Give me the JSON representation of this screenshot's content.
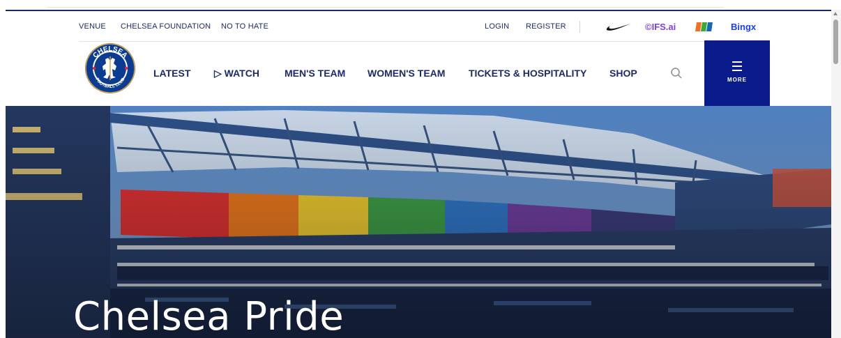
{
  "utility_links": {
    "venue": "VENUE",
    "foundation": "CHELSEA FOUNDATION",
    "no_to_hate": "NO TO HATE",
    "login": "LOGIN",
    "register": "REGISTER"
  },
  "sponsors": {
    "ifs": "©IFS.ai",
    "bingx": "Bingx"
  },
  "crest": {
    "top_text": "CHELSEA",
    "bottom_text": "FOOTBALL CLUB"
  },
  "main_nav": {
    "latest": "LATEST",
    "watch": "▷ WATCH",
    "mens": "MEN'S TEAM",
    "womens": "WOMEN'S TEAM",
    "tickets": "TICKETS & HOSPITALITY",
    "shop": "SHOP",
    "more": "MORE"
  },
  "hero": {
    "title": "Chelsea Pride"
  },
  "colors": {
    "navy": "#1b2a6b",
    "more_bg": "#0a1c8c",
    "ifs_purple": "#7b3fe4",
    "bingx_blue": "#1a3cff"
  }
}
